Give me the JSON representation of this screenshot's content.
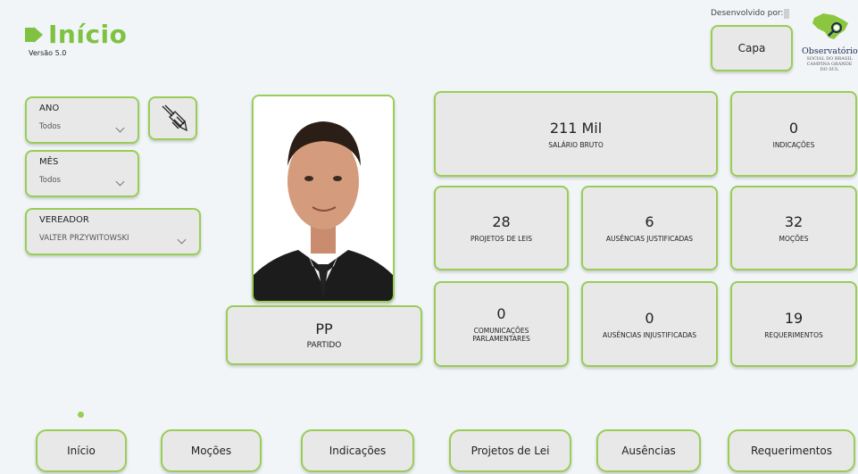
{
  "header": {
    "title": "Início",
    "version": "Versão 5.0",
    "developed_by": "Desenvolvido por:"
  },
  "capa_button": "Capa",
  "brand": {
    "name": "Observatório",
    "line1": "SOCIAL DO BRASIL",
    "line2": "CAMPINA GRANDE",
    "line3": "DO SUL",
    "accent": "#7fc242"
  },
  "filters": {
    "ano": {
      "label": "ANO",
      "value": "Todos"
    },
    "mes": {
      "label": "MÊS",
      "value": "Todos"
    },
    "vereador": {
      "label": "VEREADOR",
      "value": "VALTER PRZYWITOWSKI"
    },
    "clear_icon": "clear-filters-icon"
  },
  "partido": {
    "value": "PP",
    "label": "PARTIDO"
  },
  "stats": {
    "salario": {
      "value": "211 Mil",
      "label": "SALÁRIO BRUTO"
    },
    "indicacoes": {
      "value": "0",
      "label": "INDICAÇÕES"
    },
    "projetos": {
      "value": "28",
      "label": "PROJETOS DE LEIS"
    },
    "aus_just": {
      "value": "6",
      "label": "AUSÊNCIAS JUSTIFICADAS"
    },
    "mocoes": {
      "value": "32",
      "label": "MOÇÕES"
    },
    "comunicacoes": {
      "value": "0",
      "label_l1": "COMUNICAÇÕES",
      "label_l2": "PARLAMENTARES"
    },
    "aus_injust": {
      "value": "0",
      "label": "AUSÊNCIAS INJUSTIFICADAS"
    },
    "requerimentos": {
      "value": "19",
      "label": "REQUERIMENTOS"
    }
  },
  "nav": {
    "inicio": "Início",
    "mocoes": "Moções",
    "indicacoes": "Indicações",
    "projetos": "Projetos de Lei",
    "ausencias": "Ausências",
    "requerimentos": "Requerimentos"
  }
}
